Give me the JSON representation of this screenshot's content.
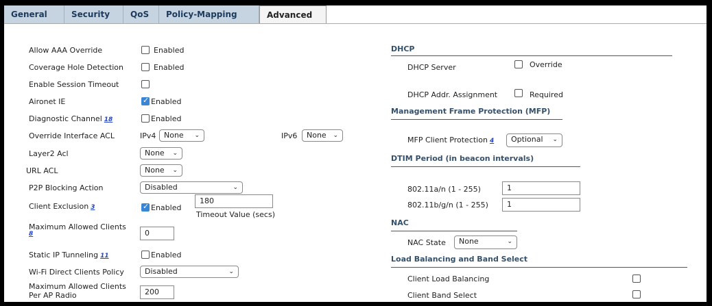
{
  "tabs": [
    "General",
    "Security",
    "QoS",
    "Policy-Mapping",
    "Advanced"
  ],
  "left": {
    "allow_aaa_override": {
      "label": "Allow AAA Override",
      "check": "Enabled"
    },
    "coverage_hole": {
      "label": "Coverage Hole Detection",
      "check": "Enabled"
    },
    "session_timeout": {
      "label": "Enable Session Timeout"
    },
    "aironet_ie": {
      "label": "Aironet IE",
      "check": "Enabled"
    },
    "diagnostic_channel": {
      "label": "Diagnostic Channel",
      "ref": "18",
      "check": "Enabled"
    },
    "override_acl": {
      "label": "Override Interface ACL",
      "ipv4_label": "IPv4",
      "ipv4_value": "None",
      "ipv6_label": "IPv6",
      "ipv6_value": "None"
    },
    "layer2_acl": {
      "label": "Layer2 Acl",
      "value": "None"
    },
    "url_acl": {
      "label": "URL ACL",
      "value": "None"
    },
    "p2p_blocking": {
      "label": "P2P Blocking Action",
      "value": "Disabled"
    },
    "client_exclusion": {
      "label": "Client Exclusion",
      "ref": "3",
      "check": "Enabled",
      "timeout_value": "180",
      "timeout_label": "Timeout Value (secs)"
    },
    "max_clients": {
      "label_line1": "Maximum Allowed Clients",
      "ref": "8",
      "value": "0"
    },
    "static_ip": {
      "label": "Static IP Tunneling",
      "ref": "11",
      "check": "Enabled"
    },
    "wifi_direct": {
      "label": "Wi-Fi Direct Clients Policy",
      "value": "Disabled"
    },
    "max_clients_ap": {
      "label_line1": "Maximum Allowed Clients",
      "label_line2": "Per AP Radio",
      "value": "200"
    }
  },
  "right": {
    "dhcp": {
      "title": "DHCP",
      "server_label": "DHCP Server",
      "server_check": "Override",
      "assign_label": "DHCP Addr. Assignment",
      "assign_check": "Required"
    },
    "mfp": {
      "title": "Management Frame Protection (MFP)",
      "label": "MFP Client Protection",
      "ref": "4",
      "value": "Optional"
    },
    "dtim": {
      "title": "DTIM Period (in beacon intervals)",
      "a_label": "802.11a/n (1 - 255)",
      "a_value": "1",
      "b_label": "802.11b/g/n (1 - 255)",
      "b_value": "1"
    },
    "nac": {
      "title": "NAC",
      "label": "NAC State",
      "value": "None"
    },
    "lb": {
      "title": "Load Balancing and Band Select",
      "load_label": "Client Load Balancing",
      "band_label": "Client Band Select"
    }
  }
}
